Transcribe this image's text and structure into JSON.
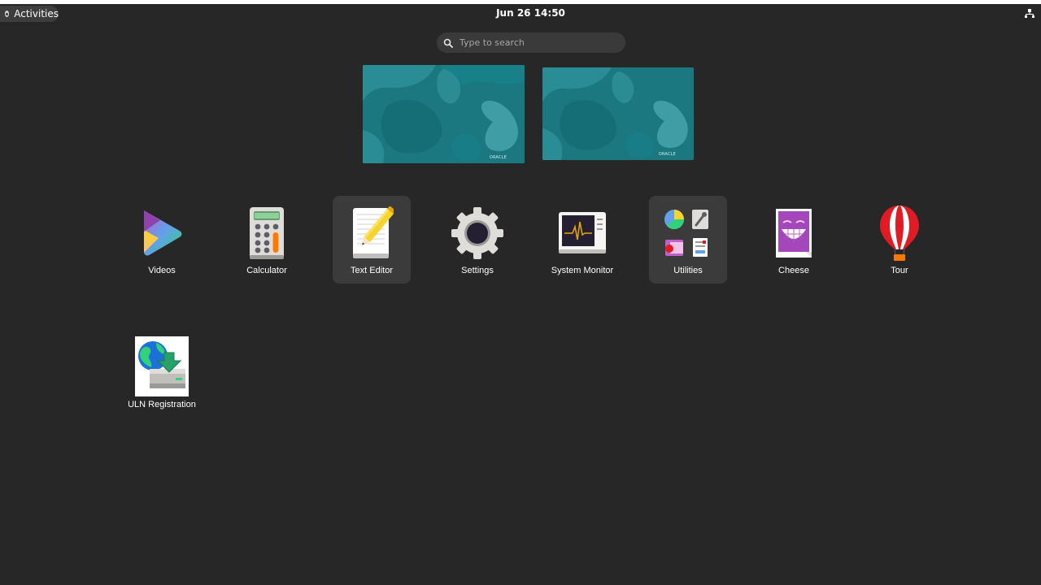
{
  "topbar": {
    "activities_label": "Activities",
    "clock": "Jun 26  14:50"
  },
  "search": {
    "placeholder": "Type to search"
  },
  "workspaces": [
    {
      "brand": "ORACLE"
    },
    {
      "brand": "ORACLE"
    }
  ],
  "apps": [
    {
      "label": "Videos",
      "icon": "videos-icon"
    },
    {
      "label": "Calculator",
      "icon": "calculator-icon"
    },
    {
      "label": "Text Editor",
      "icon": "text-editor-icon"
    },
    {
      "label": "Settings",
      "icon": "settings-gear-icon"
    },
    {
      "label": "System Monitor",
      "icon": "system-monitor-icon"
    },
    {
      "label": "Utilities",
      "icon": "utilities-folder-icon"
    },
    {
      "label": "Cheese",
      "icon": "cheese-icon"
    },
    {
      "label": "Tour",
      "icon": "tour-balloon-icon"
    },
    {
      "label": "ULN Registration",
      "icon": "uln-registration-icon"
    }
  ],
  "colors": {
    "background": "#272727",
    "highlight": "#3b3b3b",
    "wallpaper": "#1d7a82"
  }
}
